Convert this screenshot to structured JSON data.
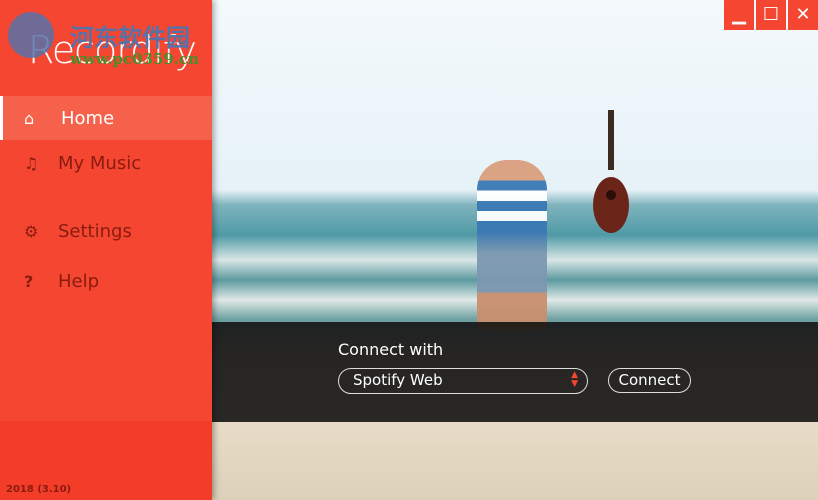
{
  "app": {
    "logo": "Recordify",
    "version": "2018 (3.10)"
  },
  "watermark": {
    "title": "河东软件园",
    "url": "www.pc0359.cn"
  },
  "sidebar": {
    "items": [
      {
        "label": "Home",
        "icon": "home-icon",
        "active": true
      },
      {
        "label": "My Music",
        "icon": "music-note-icon",
        "active": false
      },
      {
        "label": "Settings",
        "icon": "gear-icon",
        "active": false
      },
      {
        "label": "Help",
        "icon": "question-icon",
        "active": false
      }
    ]
  },
  "connect": {
    "label": "Connect with",
    "source": "Spotify Web",
    "button": "Connect"
  },
  "window": {
    "minimize": "minimize-icon",
    "maximize": "maximize-icon",
    "close": "close-icon"
  },
  "colors": {
    "accent": "#f44630",
    "active_item": "#f6614b"
  }
}
